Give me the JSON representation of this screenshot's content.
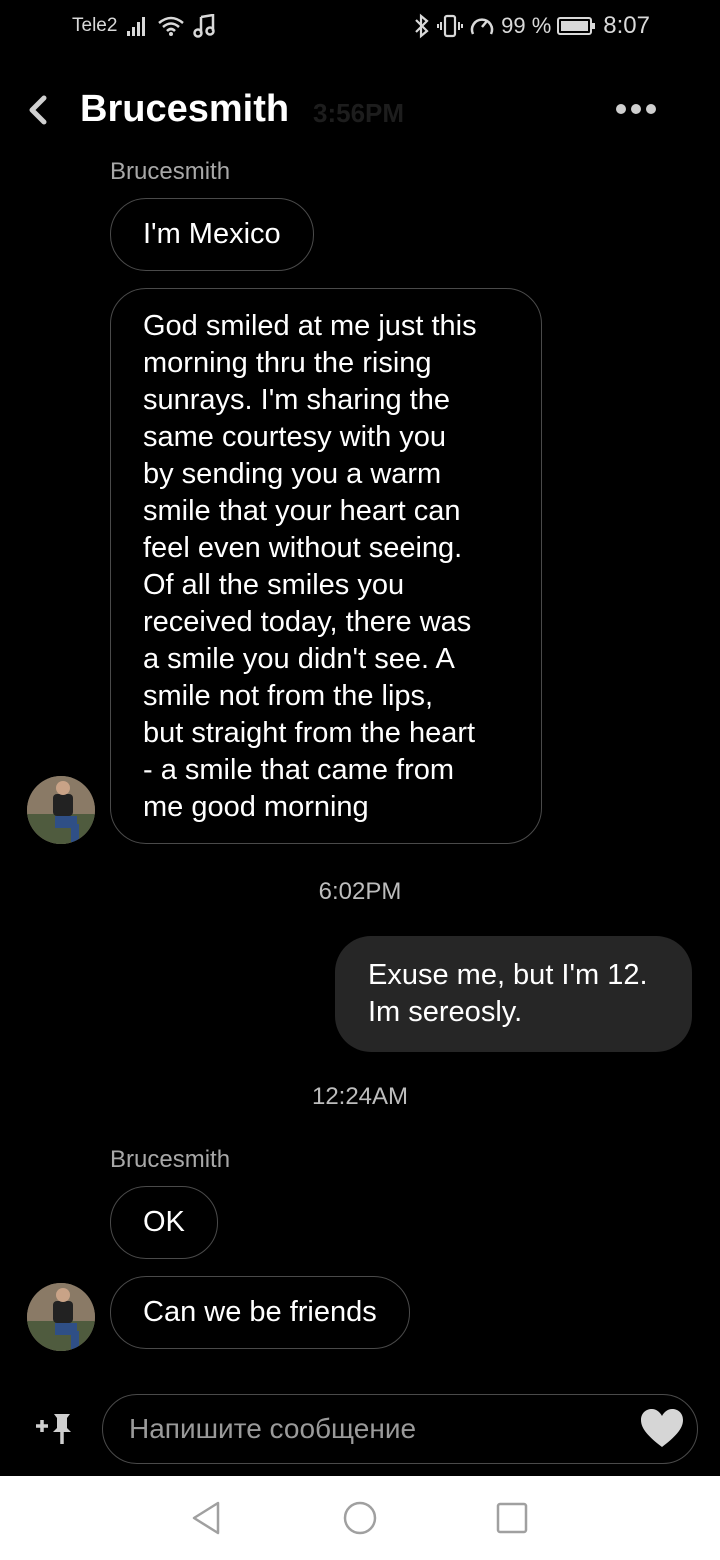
{
  "status_bar": {
    "carrier": "Tele2",
    "battery_percent": "99 %",
    "time": "8:07",
    "icons": [
      "signal-icon",
      "wifi-icon",
      "music-note-icon",
      "bluetooth-icon",
      "vibrate-icon",
      "data-saver-icon",
      "battery-icon"
    ]
  },
  "header": {
    "title": "Brucesmith",
    "ghost_text": "3:56PM",
    "back_icon": "chevron-left-icon",
    "more_icon": "more-dots-icon"
  },
  "messages": [
    {
      "type": "sender",
      "text": "Brucesmith"
    },
    {
      "type": "incoming",
      "text": "I'm Mexico"
    },
    {
      "type": "incoming",
      "lines": [
        "God smiled at me just this",
        "morning thru the rising",
        "sunrays. I'm sharing the",
        "same courtesy with you",
        "by sending you a warm",
        "smile that your heart can",
        "feel even without seeing.",
        "Of all the smiles you",
        "received today, there was",
        "a smile you didn't see. A",
        "smile not from the lips,",
        "but straight from the heart",
        "- a smile that came from",
        "me good morning"
      ]
    },
    {
      "type": "timestamp",
      "text": "6:02PM"
    },
    {
      "type": "outgoing",
      "lines": [
        "Exuse me, but I'm 12.",
        "Im sereosly."
      ]
    },
    {
      "type": "timestamp",
      "text": "12:24AM"
    },
    {
      "type": "sender",
      "text": "Brucesmith"
    },
    {
      "type": "incoming",
      "text": "OK"
    },
    {
      "type": "incoming",
      "text": "Can we be friends"
    }
  ],
  "composer": {
    "placeholder": "Напишите сообщение",
    "attach_icon": "add-pin-icon",
    "like_icon": "heart-icon"
  },
  "nav": {
    "icons": [
      "back-triangle-icon",
      "home-circle-icon",
      "recents-square-icon"
    ]
  },
  "colors": {
    "background": "#000000",
    "outgoing_bubble": "#262626",
    "incoming_border": "#4a4a4a",
    "muted_text": "#a8a8a8"
  }
}
